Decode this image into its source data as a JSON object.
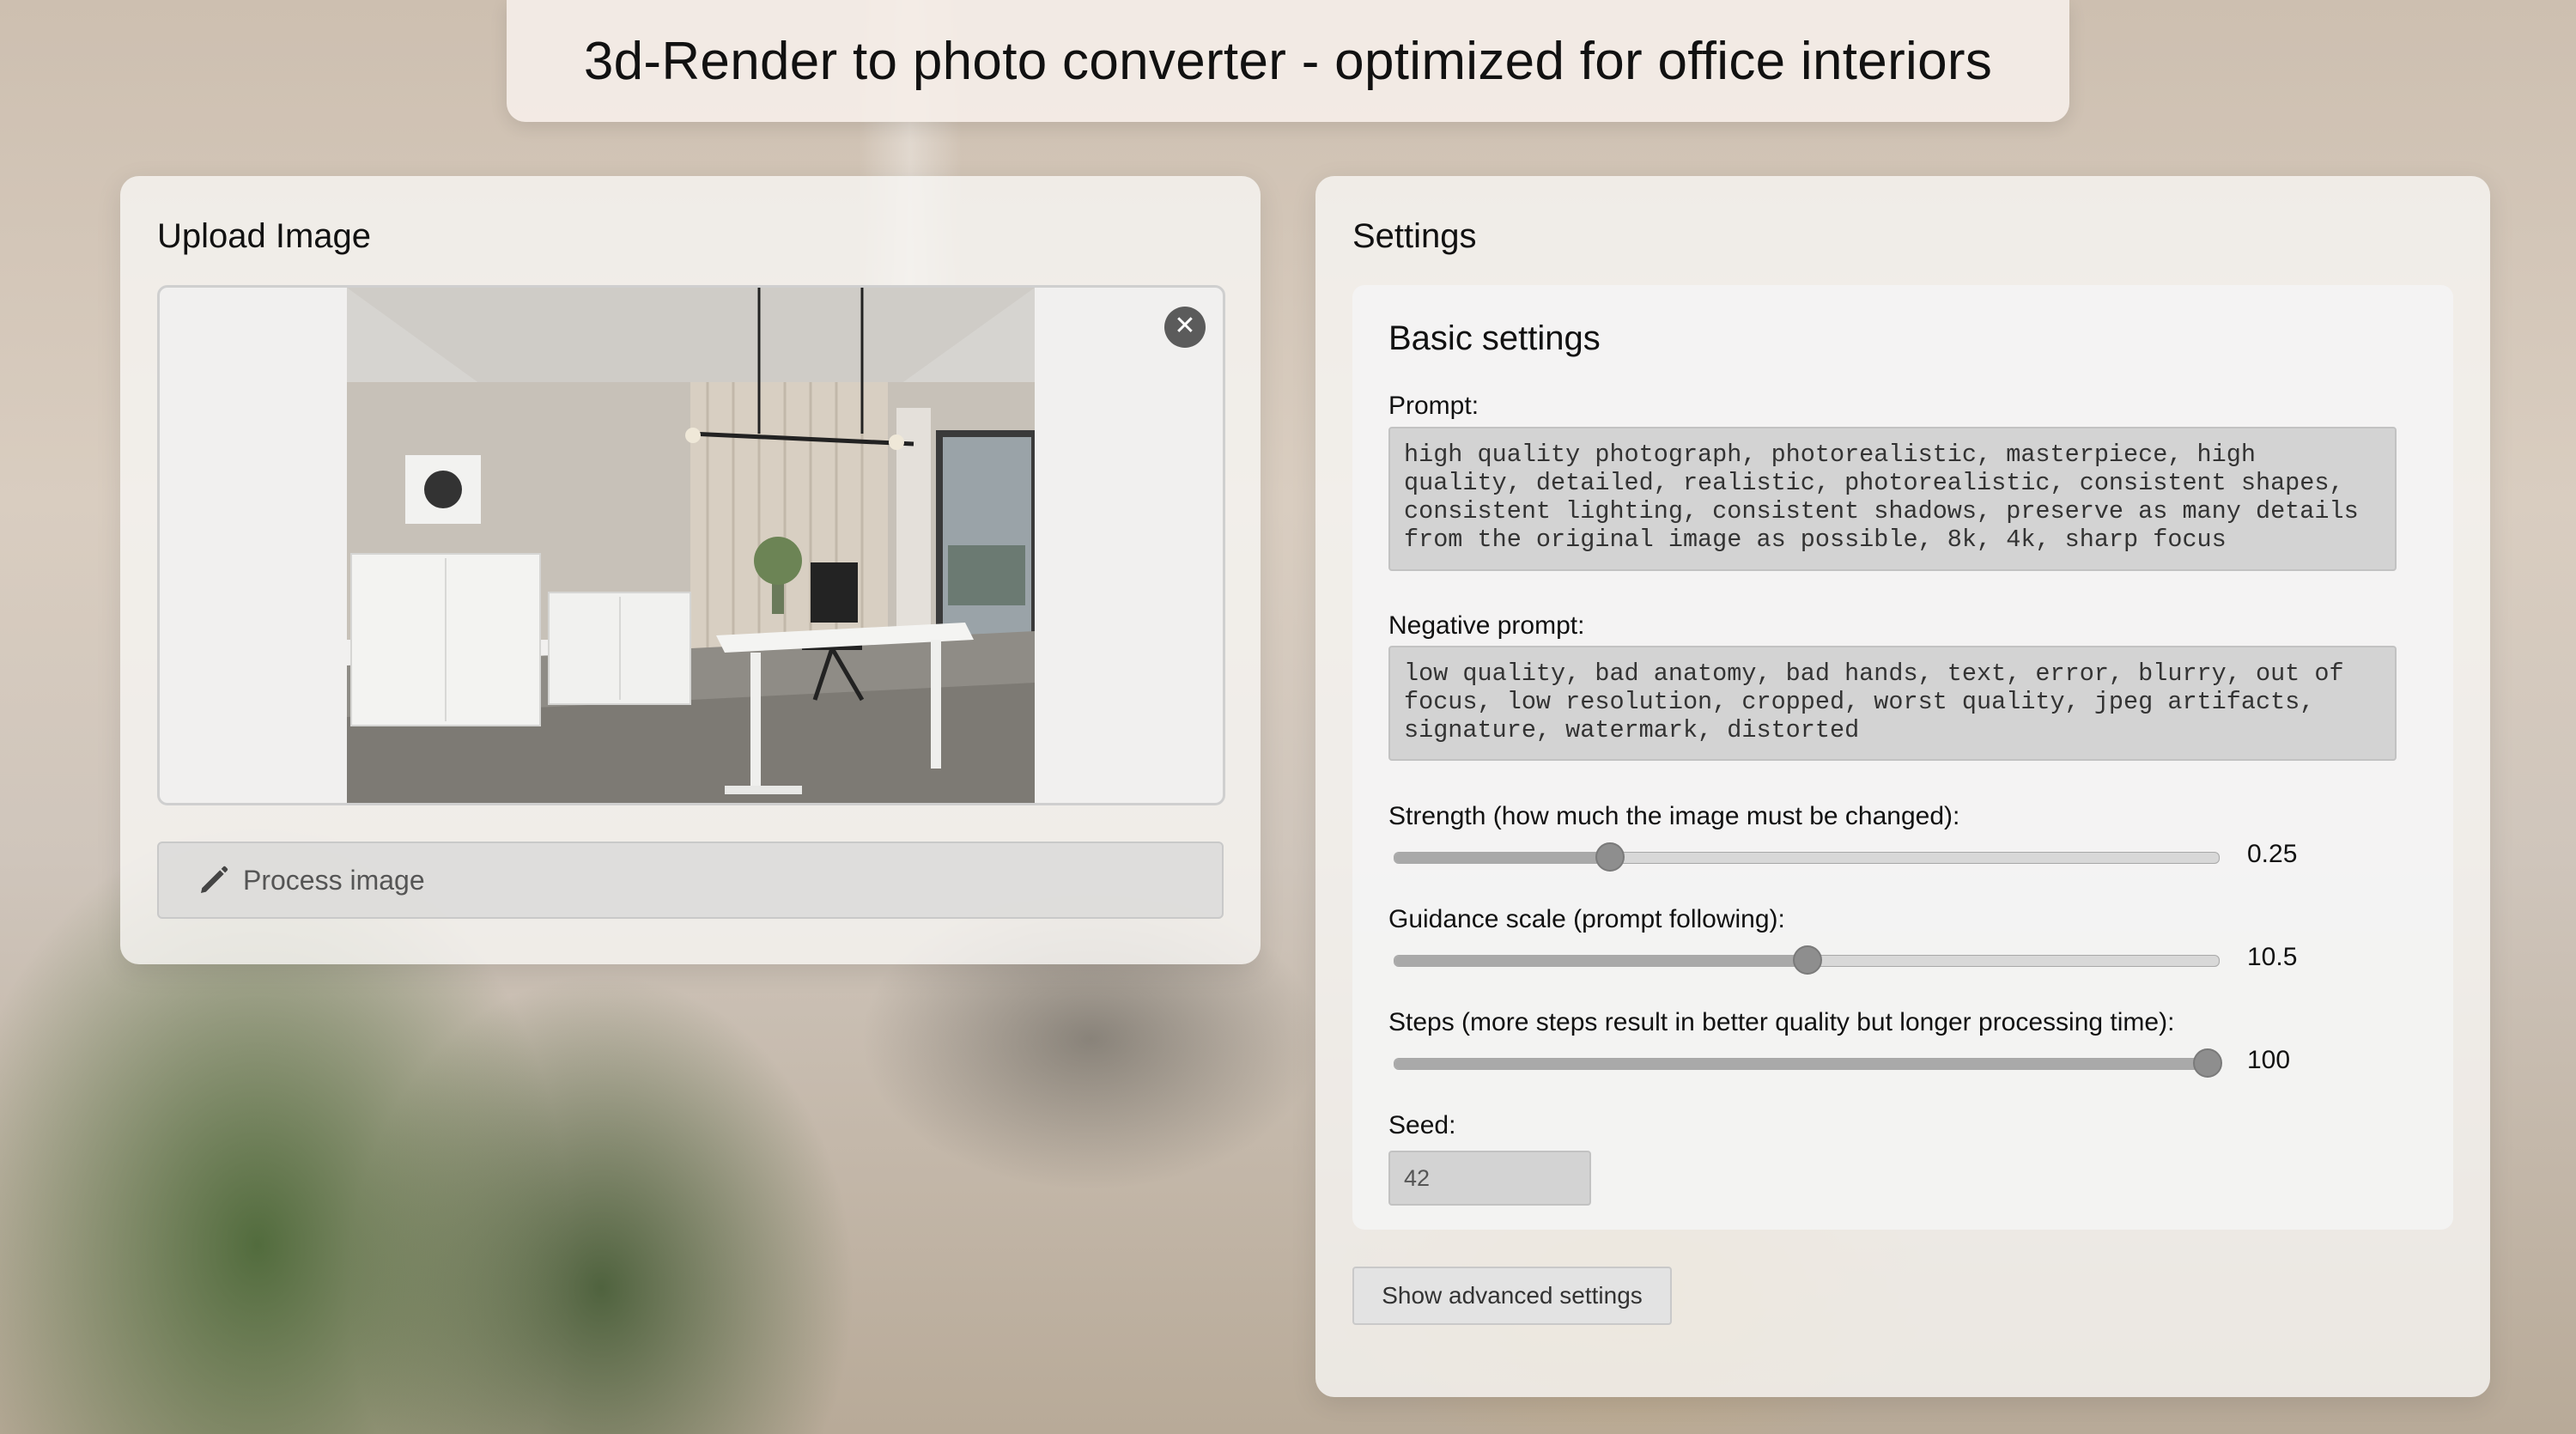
{
  "app": {
    "title": "3d-Render to photo converter - optimized for office interiors"
  },
  "upload": {
    "title": "Upload Image",
    "image_description": "office interior photo",
    "process_button": "Process image"
  },
  "settings": {
    "title": "Settings",
    "basic": {
      "title": "Basic settings",
      "prompt_label": "Prompt:",
      "prompt_value": "high quality photograph, photorealistic, masterpiece, high quality, detailed, realistic, photorealistic, consistent shapes, consistent lighting, consistent shadows, preserve as many details from the original image as possible, 8k, 4k, sharp focus",
      "negative_label": "Negative prompt:",
      "negative_value": "low quality, bad anatomy, bad hands, text, error, blurry, out of focus, low resolution, cropped, worst quality, jpeg artifacts, signature, watermark, distorted",
      "strength": {
        "label": "Strength (how much the image must be changed):",
        "value": "0.25",
        "fraction": 0.26
      },
      "guidance": {
        "label": "Guidance scale (prompt following):",
        "value": "10.5",
        "fraction": 0.5
      },
      "steps": {
        "label": "Steps (more steps result in better quality but longer processing time):",
        "value": "100",
        "fraction": 0.985
      },
      "seed_label": "Seed:",
      "seed_value": "42"
    },
    "advanced_button": "Show advanced settings"
  }
}
